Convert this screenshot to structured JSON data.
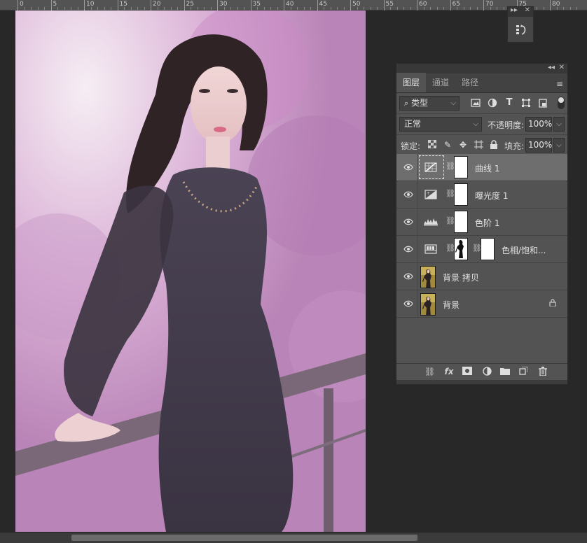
{
  "ruler": {
    "labels": [
      "0",
      "5",
      "10",
      "15",
      "20",
      "25",
      "30",
      "35",
      "40",
      "45",
      "50",
      "55",
      "60",
      "65",
      "70",
      "75",
      "80"
    ]
  },
  "history_panel": {
    "icon": "history-icon"
  },
  "layers_panel": {
    "tabs": [
      {
        "label": "图层",
        "active": true
      },
      {
        "label": "通道",
        "active": false
      },
      {
        "label": "路径",
        "active": false
      }
    ],
    "filter": {
      "label": "类型"
    },
    "blend_mode": "正常",
    "opacity_label": "不透明度:",
    "opacity_value": "100%",
    "lock_label": "锁定:",
    "fill_label": "填充:",
    "fill_value": "100%",
    "layers": [
      {
        "name": "曲线 1",
        "type": "curves",
        "selected": true
      },
      {
        "name": "曝光度 1",
        "type": "exposure",
        "selected": false
      },
      {
        "name": "色阶 1",
        "type": "levels",
        "selected": false
      },
      {
        "name": "色相/饱和...",
        "type": "hue-saturation",
        "selected": false
      },
      {
        "name": "背景 拷贝",
        "type": "image",
        "selected": false
      },
      {
        "name": "背景",
        "type": "image-locked",
        "selected": false
      }
    ]
  },
  "colors": {
    "panel_bg": "#535353",
    "selected_layer": "#6e6e6e",
    "canvas_bg": "#282828"
  }
}
